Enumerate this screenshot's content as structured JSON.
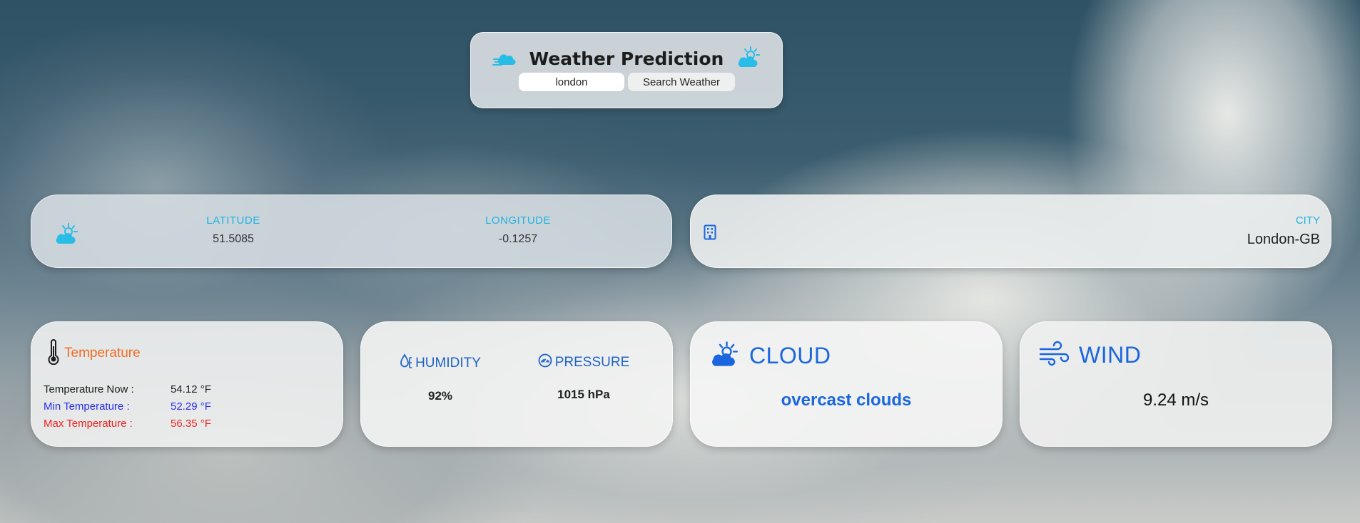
{
  "header": {
    "title": "Weather Prediction",
    "left_icon": "wind-cloud-icon",
    "right_icon": "sun-cloud-icon"
  },
  "search": {
    "value": "london",
    "button_label": "Search Weather"
  },
  "coords": {
    "icon": "sun-cloud-icon",
    "latitude_label": "LATITUDE",
    "latitude_value": "51.5085",
    "longitude_label": "LONGITUDE",
    "longitude_value": "-0.1257"
  },
  "city": {
    "icon": "building-icon",
    "label": "CITY",
    "value": "London-GB"
  },
  "temperature": {
    "icon": "thermometer-icon",
    "title": "Temperature",
    "now_label": "Temperature Now :",
    "now_value": "54.12 °F",
    "min_label": "Min Temperature :",
    "min_value": "52.29 °F",
    "max_label": "Max Temperature :",
    "max_value": "56.35 °F"
  },
  "humidity": {
    "icon": "droplet-icon",
    "label": "HUMIDITY",
    "value": "92%"
  },
  "pressure": {
    "icon": "gauge-icon",
    "label": "PRESSURE",
    "value": "1015 hPa"
  },
  "cloud": {
    "icon": "sun-cloud-icon",
    "label": "CLOUD",
    "description": "overcast clouds"
  },
  "wind": {
    "icon": "wind-icon",
    "label": "WIND",
    "value": "9.24 m/s"
  },
  "colors": {
    "accent_cyan": "#1fb3e0",
    "accent_blue": "#1b66de",
    "temperature_orange": "#f26b21",
    "min_blue": "#2a2ee8",
    "max_red": "#ee2222"
  }
}
